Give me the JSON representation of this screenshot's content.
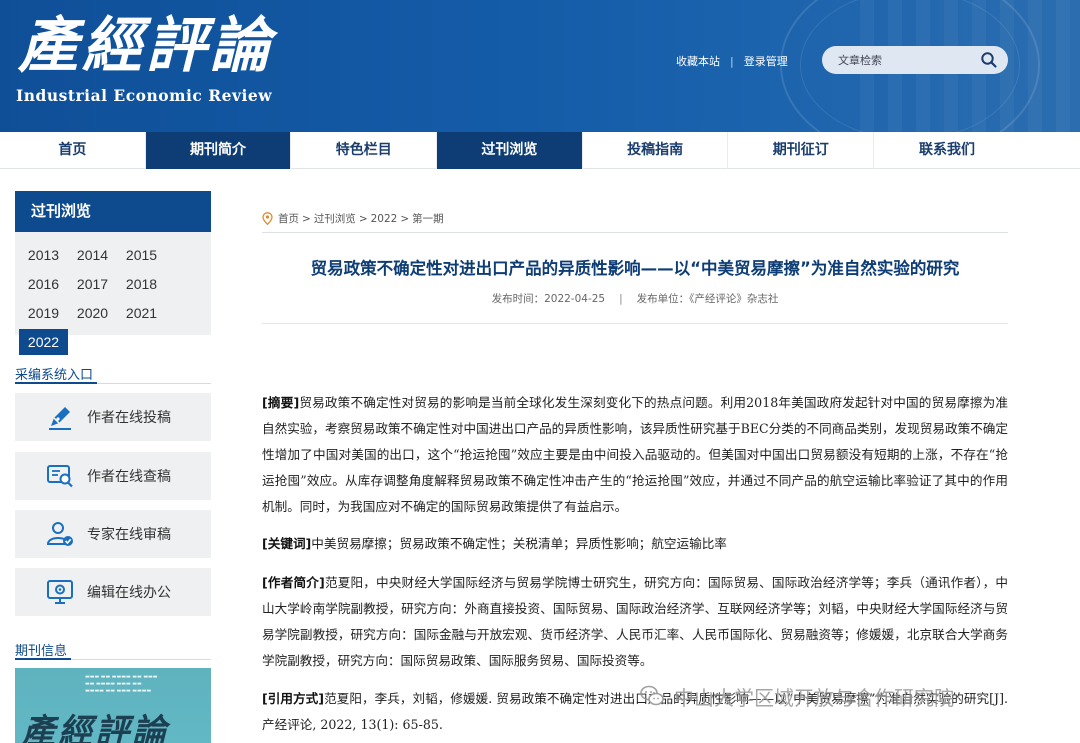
{
  "header": {
    "logo_cn": "產經評論",
    "logo_en": "Industrial Economic Review",
    "links": [
      "收藏本站",
      "登录管理"
    ],
    "search_placeholder": "文章检索"
  },
  "nav": {
    "items": [
      "首页",
      "期刊简介",
      "特色栏目",
      "过刊浏览",
      "投稿指南",
      "期刊征订",
      "联系我们"
    ]
  },
  "sidebar": {
    "archive_title": "过刊浏览",
    "years": [
      "2013",
      "2014",
      "2015",
      "2016",
      "2017",
      "2018",
      "2019",
      "2020",
      "2021",
      "2022"
    ],
    "active_year": "2022",
    "system_title": "采编系统入口",
    "entries": [
      "作者在线投稿",
      "作者在线查稿",
      "专家在线审稿",
      "编辑在线办公"
    ],
    "journal_title": "期刊信息",
    "cover_title": "產經評論"
  },
  "breadcrumb": [
    "首页",
    ">",
    "过刊浏览",
    ">",
    "2022",
    ">",
    "第一期"
  ],
  "article": {
    "title": "贸易政策不确定性对进出口产品的异质性影响——以“中美贸易摩擦”为准自然实验的研究",
    "date": "发布时间：2022-04-25",
    "separator": "|",
    "publisher": "发布单位：《产经评论》杂志社",
    "abstract_label": "[摘要]",
    "abstract": "贸易政策不确定性对贸易的影响是当前全球化发生深刻变化下的热点问题。利用2018年美国政府发起针对中国的贸易摩擦为准自然实验，考察贸易政策不确定性对中国进出口产品的异质性影响，该异质性研究基于BEC分类的不同商品类别，发现贸易政策不确定性增加了中国对美国的出口，这个“抢运抢囤”效应主要是由中间投入品驱动的。但美国对中国出口贸易额没有短期的上涨，不存在“抢运抢囤”效应。从库存调整角度解释贸易政策不确定性冲击产生的“抢运抢囤”效应，并通过不同产品的航空运输比率验证了其中的作用机制。同时，为我国应对不确定的国际贸易政策提供了有益启示。",
    "keywords_label": "[关键词]",
    "keywords": "中美贸易摩擦；贸易政策不确定性；关税清单；异质性影响；航空运输比率",
    "authors_label": "[作者简介]",
    "authors": "范夏阳，中央财经大学国际经济与贸易学院博士研究生，研究方向：国际贸易、国际政治经济学等；李兵（通讯作者），中山大学岭南学院副教授，研究方向：外商直接投资、国际贸易、国际政治经济学、互联网经济学等；刘韬，中央财经大学国际经济与贸易学院副教授，研究方向：国际金融与开放宏观、货币经济学、人民币汇率、人民币国际化、贸易融资等；修媛媛，北京联合大学商务学院副教授，研究方向：国际贸易政策、国际服务贸易、国际投资等。",
    "citation_label": "[引用方式]",
    "citation": "范夏阳，李兵，刘韬，修媛媛. 贸易政策不确定性对进出口产品的异质性影响——以“中美贸易摩擦”为准自然实验的研究[J]. 产经评论, 2022, 13(1): 65-85."
  },
  "watermark": "中山大学区域开放与合作研究院"
}
